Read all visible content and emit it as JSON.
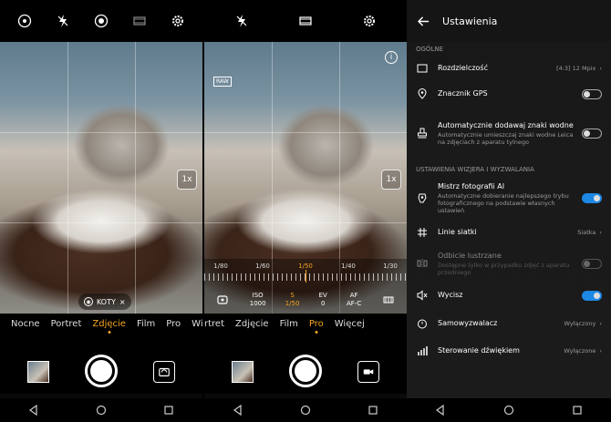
{
  "photo_mode": {
    "modes": [
      "Nocne",
      "Portret",
      "Zdjęcie",
      "Film",
      "Pro",
      "Więcej"
    ],
    "active_mode": "Zdjęcie",
    "zoom_label": "1x",
    "tag_label": "KOTY",
    "tag_close": "×"
  },
  "pro_mode": {
    "modes": [
      "rtret",
      "Zdjęcie",
      "Film",
      "Pro",
      "Więcej"
    ],
    "active_mode": "Pro",
    "zoom_label": "1x",
    "shutter_ruler": [
      "1/80",
      "1/60",
      "1/50",
      "1/40",
      "1/30"
    ],
    "active_shutter": "1/50",
    "params": [
      {
        "top": "ISO",
        "bottom": "1000"
      },
      {
        "top": "S",
        "bottom": "1/50"
      },
      {
        "top": "EV",
        "bottom": "0"
      },
      {
        "top": "AF",
        "bottom": "AF-C"
      }
    ],
    "raw_badge": "RAW",
    "info": "i"
  },
  "settings": {
    "title": "Ustawienia",
    "section_general": "OGÓLNE",
    "resolution": {
      "label": "Rozdzielczość",
      "value": "[4:3] 12 Mpix"
    },
    "gps": {
      "label": "Znacznik GPS"
    },
    "watermark": {
      "label": "Automatycznie dodawaj znaki wodne",
      "sub": "Automatycznie umieszczaj znaki wodne Leica na zdjęciach z aparatu tylnego"
    },
    "section_viewfinder": "USTAWIENIA WIZJERA I WYZWALANIA",
    "master_ai": {
      "label": "Mistrz fotografii AI",
      "sub": "Automatyczne dobieranie najlepszego trybu fotograficznego na podstawie własnych ustawień"
    },
    "grid": {
      "label": "Linie siatki",
      "value": "Siatka"
    },
    "mirror": {
      "label": "Odbicie lustrzane",
      "sub": "Dostępne tylko w przypadku zdjęć z aparatu przedniego"
    },
    "mute": {
      "label": "Wycisz"
    },
    "timer": {
      "label": "Samowyzwalacz",
      "value": "Wyłączony"
    },
    "sound_control": {
      "label": "Sterowanie dźwiękiem",
      "value": "Wyłączone"
    }
  }
}
